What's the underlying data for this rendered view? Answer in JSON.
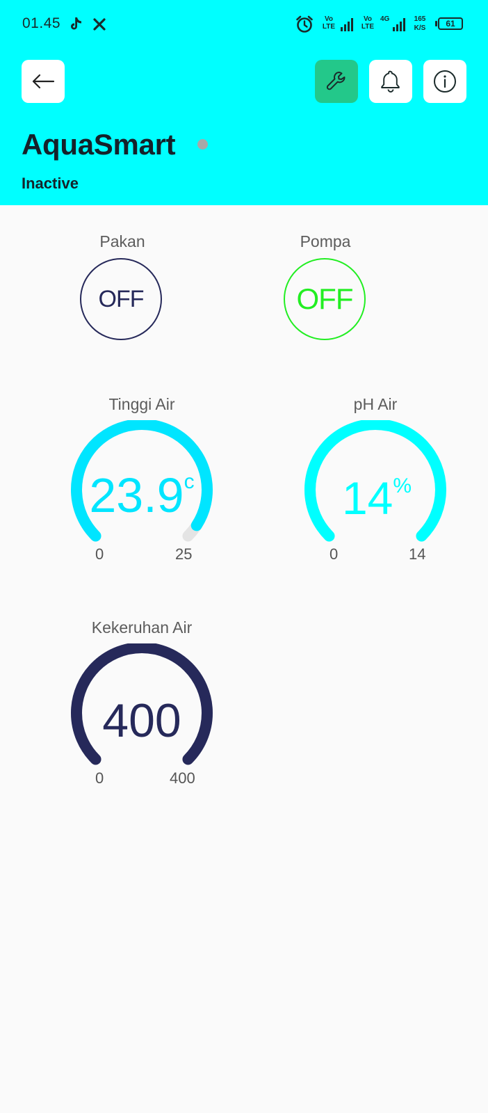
{
  "status_bar": {
    "time": "01.45",
    "volte_1": "Vo LTE",
    "volte_2": "Vo LTE",
    "network_type": "4G",
    "speed_value": "165",
    "speed_unit": "K/S",
    "battery": "61"
  },
  "header": {
    "title": "AquaSmart",
    "status": "Inactive",
    "colors": {
      "background": "#00ffff",
      "settings_button": "#23c88a",
      "status_dot": "#a8a8a8"
    }
  },
  "switches": [
    {
      "label": "Pakan",
      "value": "OFF",
      "color": "#26295a"
    },
    {
      "label": "Pompa",
      "value": "OFF",
      "color": "#22ee22"
    }
  ],
  "gauges": [
    {
      "label": "Tinggi Air",
      "value": "23.9",
      "unit": "c",
      "min": "0",
      "max": "25",
      "fraction": 0.956,
      "color": "#00e5ff"
    },
    {
      "label": "pH Air",
      "value": "14",
      "unit": "%",
      "min": "0",
      "max": "14",
      "fraction": 1.0,
      "color": "#00ffff"
    },
    {
      "label": "Kekeruhan Air",
      "value": "400",
      "unit": "",
      "min": "0",
      "max": "400",
      "fraction": 1.0,
      "color": "#26295a"
    }
  ]
}
